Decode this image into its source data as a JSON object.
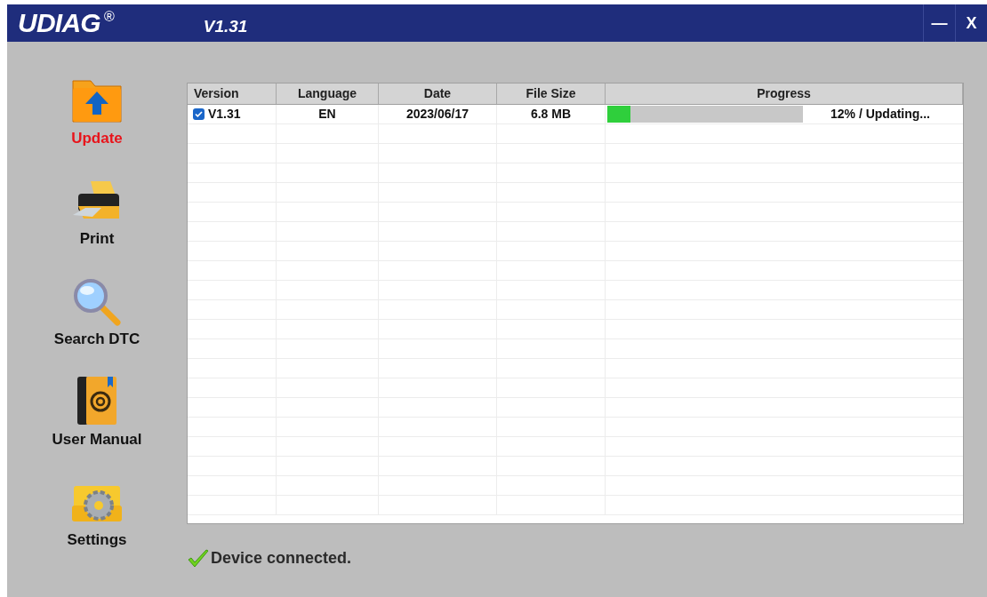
{
  "window": {
    "logo": "UDIAG",
    "logo_mark": "®",
    "version": "V1.31",
    "buttons": [
      "—",
      "X"
    ]
  },
  "sidebar": {
    "items": [
      {
        "label": "Update",
        "kind": "update",
        "selected": true
      },
      {
        "label": "Print",
        "kind": "print",
        "selected": false
      },
      {
        "label": "Search DTC",
        "kind": "search",
        "selected": false
      },
      {
        "label": "User Manual",
        "kind": "manual",
        "selected": false
      },
      {
        "label": "Settings",
        "kind": "settings",
        "selected": false
      }
    ]
  },
  "table": {
    "columns": [
      "Version",
      "Language",
      "Date",
      "File Size",
      "Progress"
    ],
    "rows": [
      {
        "checked": true,
        "version": "V1.31",
        "language": "EN",
        "date": "2023/06/17",
        "size": "6.8 MB",
        "level": 0.12,
        "status": "12% / Updating..."
      }
    ]
  },
  "status_bar": {
    "message": "Device connected."
  }
}
